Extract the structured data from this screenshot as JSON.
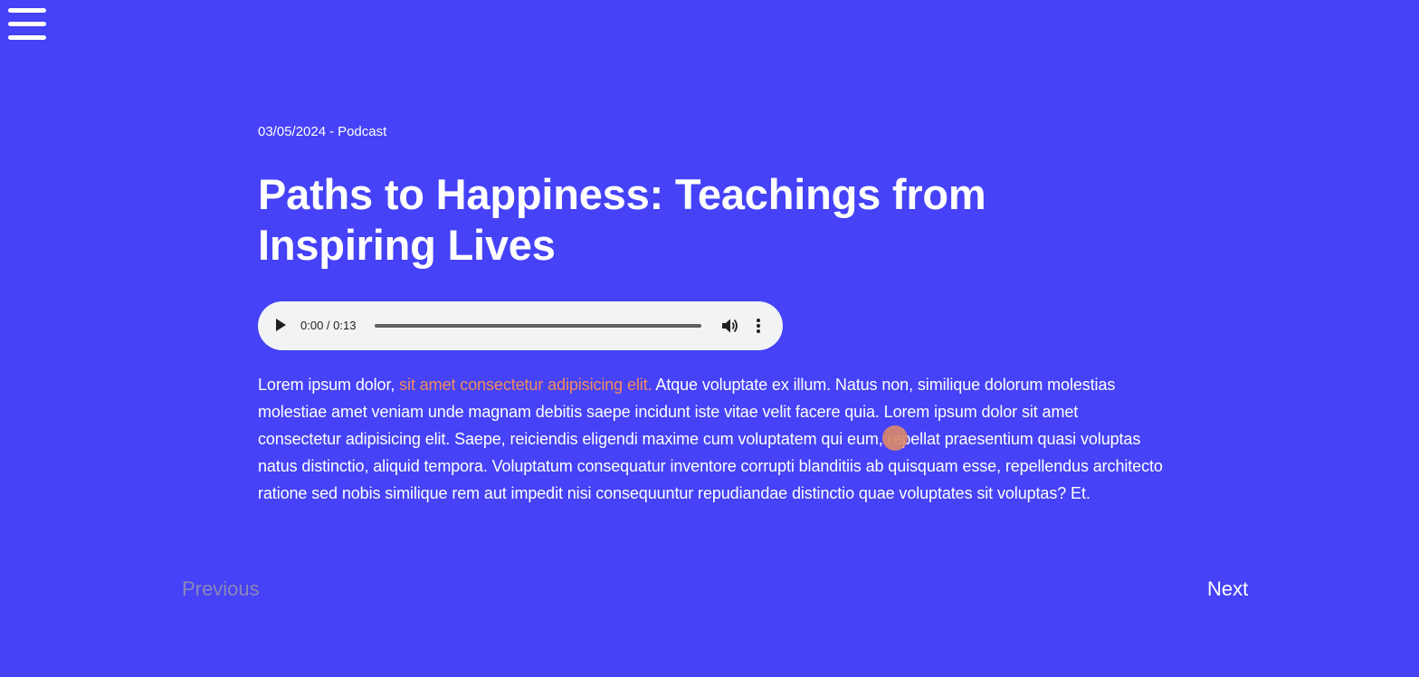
{
  "menu": {
    "icon": "hamburger-menu-icon"
  },
  "article": {
    "date": "03/05/2024",
    "separator": "-",
    "category": "Podcast",
    "title": "Paths to Happiness: Teachings from Inspiring Lives",
    "audio": {
      "time_display": "0:00 / 0:13",
      "progress": 0,
      "play_icon": "play-icon",
      "volume_icon": "volume-icon",
      "more_icon": "more-options-icon"
    },
    "body_intro": "Lorem ipsum dolor, ",
    "body_link": "sit amet consectetur adipisicing elit.",
    "body_rest": " Atque voluptate ex illum. Natus non, similique dolorum molestias molestiae amet veniam unde magnam debitis saepe incidunt iste vitae velit facere quia. Lorem ipsum dolor sit amet consectetur adipisicing elit. Saepe, reiciendis eligendi maxime cum voluptatem qui eum, repellat praesentium quasi voluptas natus distinctio, aliquid tempora. Voluptatum consequatur inventore corrupti blanditiis ab quisquam esse, repellendus architecto ratione sed nobis similique rem aut impedit nisi consequuntur repudiandae distinctio quae voluptates sit voluptas? Et."
  },
  "pagination": {
    "previous_label": "Previous",
    "next_label": "Next"
  },
  "colors": {
    "background": "#4542f7",
    "text": "#ffffff",
    "link": "#f28c5c",
    "disabled": "#8b86b8",
    "cursor": "#d9876b"
  }
}
